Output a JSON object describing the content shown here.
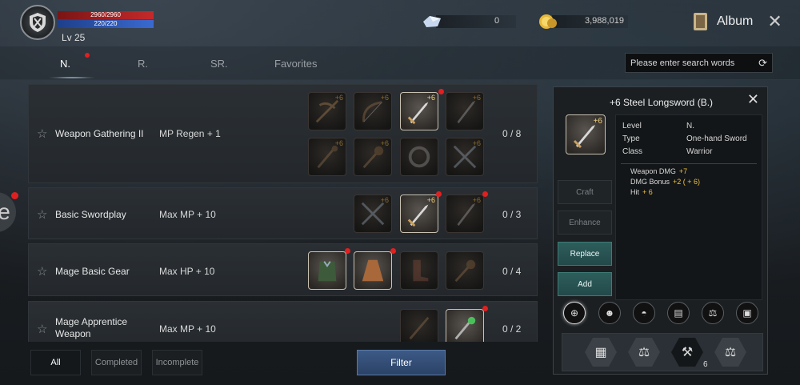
{
  "player": {
    "hp_text": "2960/2960",
    "mp_text": "220/220",
    "level": "Lv 25"
  },
  "currency": {
    "crystal": "0",
    "gold": "3,988,019"
  },
  "header": {
    "album_label": "Album"
  },
  "tabs": [
    {
      "label": "N.",
      "active": true,
      "dot": true
    },
    {
      "label": "R.",
      "active": false,
      "dot": false
    },
    {
      "label": "SR.",
      "active": false,
      "dot": false
    },
    {
      "label": "Favorites",
      "active": false,
      "dot": false
    }
  ],
  "search": {
    "placeholder": "Please enter search words"
  },
  "collections": [
    {
      "name": "Weapon Gathering II",
      "stat": "MP Regen + 1",
      "count": "0 / 8"
    },
    {
      "name": "Basic Swordplay",
      "stat": "Max MP + 10",
      "count": "0 / 3"
    },
    {
      "name": "Mage Basic Gear",
      "stat": "Max HP + 10",
      "count": "0 / 4"
    },
    {
      "name": "Mage Apprentice Weapon",
      "stat": "Max MP + 10",
      "count": "0 / 2"
    }
  ],
  "item_enchant": "+6",
  "filters": {
    "all": "All",
    "completed": "Completed",
    "incomplete": "Incomplete",
    "filter_button": "Filter"
  },
  "detail": {
    "title": "+6 Steel Longsword (B.)",
    "enchant": "+6",
    "level_label": "Level",
    "level_value": "N.",
    "type_label": "Type",
    "type_value": "One-hand Sword",
    "class_label": "Class",
    "class_value": "Warrior",
    "stats": [
      {
        "label": "Weapon DMG",
        "value": "+7"
      },
      {
        "label": "DMG Bonus",
        "value": "+2 ( + 6)"
      },
      {
        "label": "Hit",
        "value": "+ 6"
      }
    ],
    "buttons": {
      "craft": "Craft",
      "enhance": "Enhance",
      "replace": "Replace",
      "add": "Add"
    },
    "hammer_count": "6"
  },
  "colors": {
    "hp": "#c42a2a",
    "mp": "#3a6ad0",
    "accent_teal": "#2d5e5c",
    "filter_blue": "#3c5a86",
    "notify_red": "#e02020",
    "enchant_gold": "#f4d27a"
  }
}
